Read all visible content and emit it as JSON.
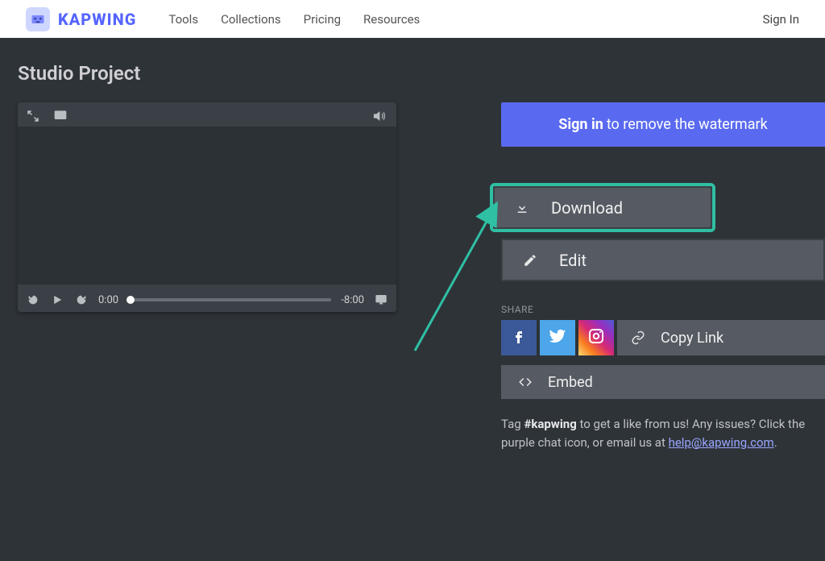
{
  "brand": {
    "name": "KAPWING"
  },
  "nav": {
    "links": [
      "Tools",
      "Collections",
      "Pricing",
      "Resources"
    ],
    "signin": "Sign In"
  },
  "page": {
    "title": "Studio Project"
  },
  "player": {
    "current_time": "0:00",
    "remaining_time": "-8:00"
  },
  "cta": {
    "signin_prefix": "Sign in",
    "signin_rest": " to remove the watermark"
  },
  "actions": {
    "download": "Download",
    "edit": "Edit",
    "copy_link": "Copy Link",
    "embed": "Embed"
  },
  "share": {
    "label": "SHARE"
  },
  "footer": {
    "pre": "Tag ",
    "hashtag": "#kapwing",
    "mid": " to get a like from us! Any issues? Click the purple chat icon, or email us at ",
    "email": "help@kapwing.com",
    "post": "."
  }
}
